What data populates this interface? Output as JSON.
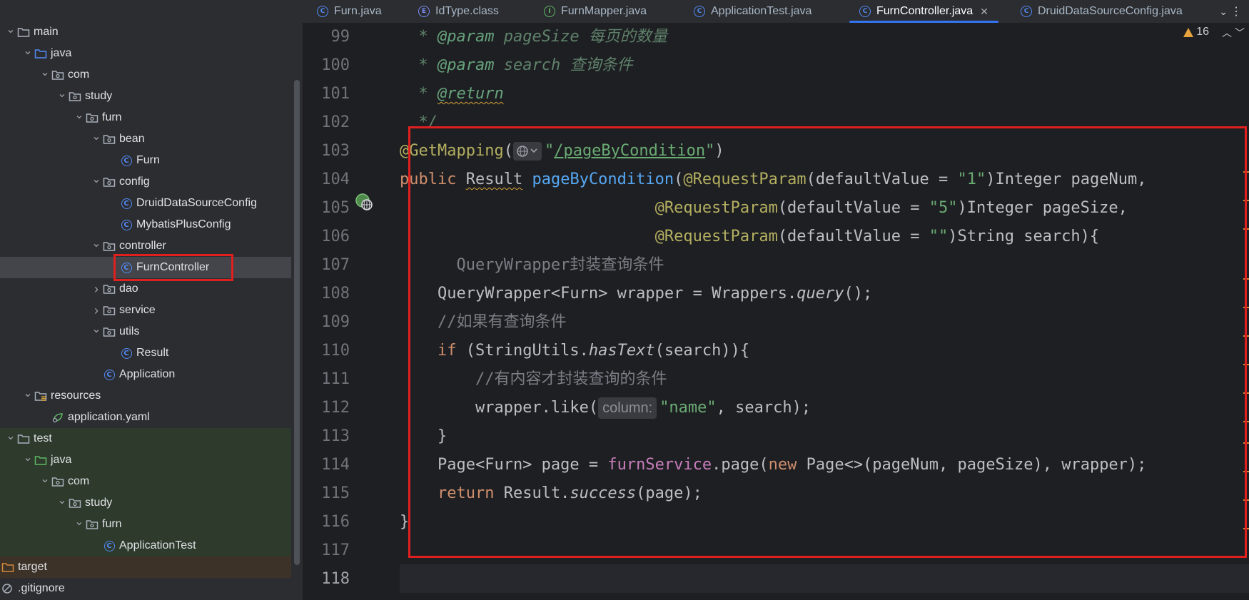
{
  "project_tree": {
    "items": [
      {
        "label": "main",
        "level": 0,
        "expanded": true,
        "kind": "folder"
      },
      {
        "label": "java",
        "level": 1,
        "expanded": true,
        "kind": "src-folder"
      },
      {
        "label": "com",
        "level": 2,
        "expanded": true,
        "kind": "package"
      },
      {
        "label": "study",
        "level": 3,
        "expanded": true,
        "kind": "package"
      },
      {
        "label": "furn",
        "level": 4,
        "expanded": true,
        "kind": "package"
      },
      {
        "label": "bean",
        "level": 5,
        "expanded": true,
        "kind": "package"
      },
      {
        "label": "Furn",
        "level": 6,
        "kind": "class"
      },
      {
        "label": "config",
        "level": 5,
        "expanded": true,
        "kind": "package"
      },
      {
        "label": "DruidDataSourceConfig",
        "level": 6,
        "kind": "class"
      },
      {
        "label": "MybatisPlusConfig",
        "level": 6,
        "kind": "class"
      },
      {
        "label": "controller",
        "level": 5,
        "expanded": true,
        "kind": "package"
      },
      {
        "label": "FurnController",
        "level": 6,
        "kind": "class",
        "selected": true
      },
      {
        "label": "dao",
        "level": 5,
        "expanded": false,
        "kind": "package"
      },
      {
        "label": "service",
        "level": 5,
        "expanded": false,
        "kind": "package"
      },
      {
        "label": "utils",
        "level": 5,
        "expanded": true,
        "kind": "package"
      },
      {
        "label": "Result",
        "level": 6,
        "kind": "class"
      },
      {
        "label": "Application",
        "level": 5,
        "kind": "spring-class"
      },
      {
        "label": "resources",
        "level": 1,
        "expanded": true,
        "kind": "resources-folder"
      },
      {
        "label": "application.yaml",
        "level": 2,
        "kind": "yaml"
      },
      {
        "label": "test",
        "level": 0,
        "expanded": true,
        "kind": "folder",
        "test": true
      },
      {
        "label": "java",
        "level": 1,
        "expanded": true,
        "kind": "test-folder",
        "test": true
      },
      {
        "label": "com",
        "level": 2,
        "expanded": true,
        "kind": "package",
        "test": true
      },
      {
        "label": "study",
        "level": 3,
        "expanded": true,
        "kind": "package",
        "test": true
      },
      {
        "label": "furn",
        "level": 4,
        "expanded": true,
        "kind": "package",
        "test": true
      },
      {
        "label": "ApplicationTest",
        "level": 5,
        "kind": "class",
        "test": true
      },
      {
        "label": "target",
        "level": -1,
        "kind": "target-folder"
      },
      {
        "label": ".gitignore",
        "level": -1,
        "kind": "file"
      }
    ]
  },
  "tabs": [
    {
      "label": "Furn.java",
      "icon": "class-icon",
      "letter": "C"
    },
    {
      "label": "IdType.class",
      "icon": "enum-icon",
      "letter": "E"
    },
    {
      "label": "FurnMapper.java",
      "icon": "interface-icon",
      "letter": "I"
    },
    {
      "label": "ApplicationTest.java",
      "icon": "class-icon",
      "letter": "C"
    },
    {
      "label": "FurnController.java",
      "icon": "class-icon",
      "letter": "C",
      "active": true,
      "close": "✕"
    },
    {
      "label": "DruidDataSourceConfig.java",
      "icon": "class-icon",
      "letter": "C"
    }
  ],
  "editor": {
    "warnings": "16",
    "line_numbers": [
      "99",
      "100",
      "101",
      "102",
      "103",
      "104",
      "105",
      "106",
      "107",
      "108",
      "109",
      "110",
      "111",
      "112",
      "113",
      "114",
      "115",
      "116",
      "117",
      "118"
    ],
    "inlay_hint_column": "column:"
  },
  "colors": {
    "highlight_box": "#e0201f",
    "active_tab_underline": "#3574f0",
    "keyword": "#cf8e6d",
    "string": "#6aab73",
    "annotation": "#b3ae60",
    "method": "#56a8f5"
  }
}
